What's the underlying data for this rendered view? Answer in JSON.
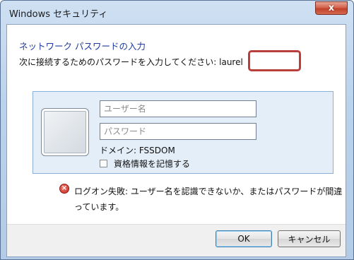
{
  "window": {
    "title": "Windows セキュリティ",
    "close_label": "x"
  },
  "main": {
    "heading": "ネットワーク パスワードの入力",
    "instruction": "次に接続するためのパスワードを入力してください: laurel"
  },
  "credentials": {
    "username_placeholder": "ユーザー名",
    "password_placeholder": "パスワード",
    "domain_text": "ドメイン: FSSDOM",
    "remember_label": "資格情報を記憶する"
  },
  "error": {
    "icon": "error-x-icon",
    "message": "ログオン失敗: ユーザー名を認識できないか、またはパスワードが間違っています。"
  },
  "buttons": {
    "ok": "OK",
    "cancel": "キャンセル"
  },
  "colors": {
    "heading": "#1e3a9c",
    "highlight": "#b9403a",
    "tile": "#e4eef9"
  }
}
